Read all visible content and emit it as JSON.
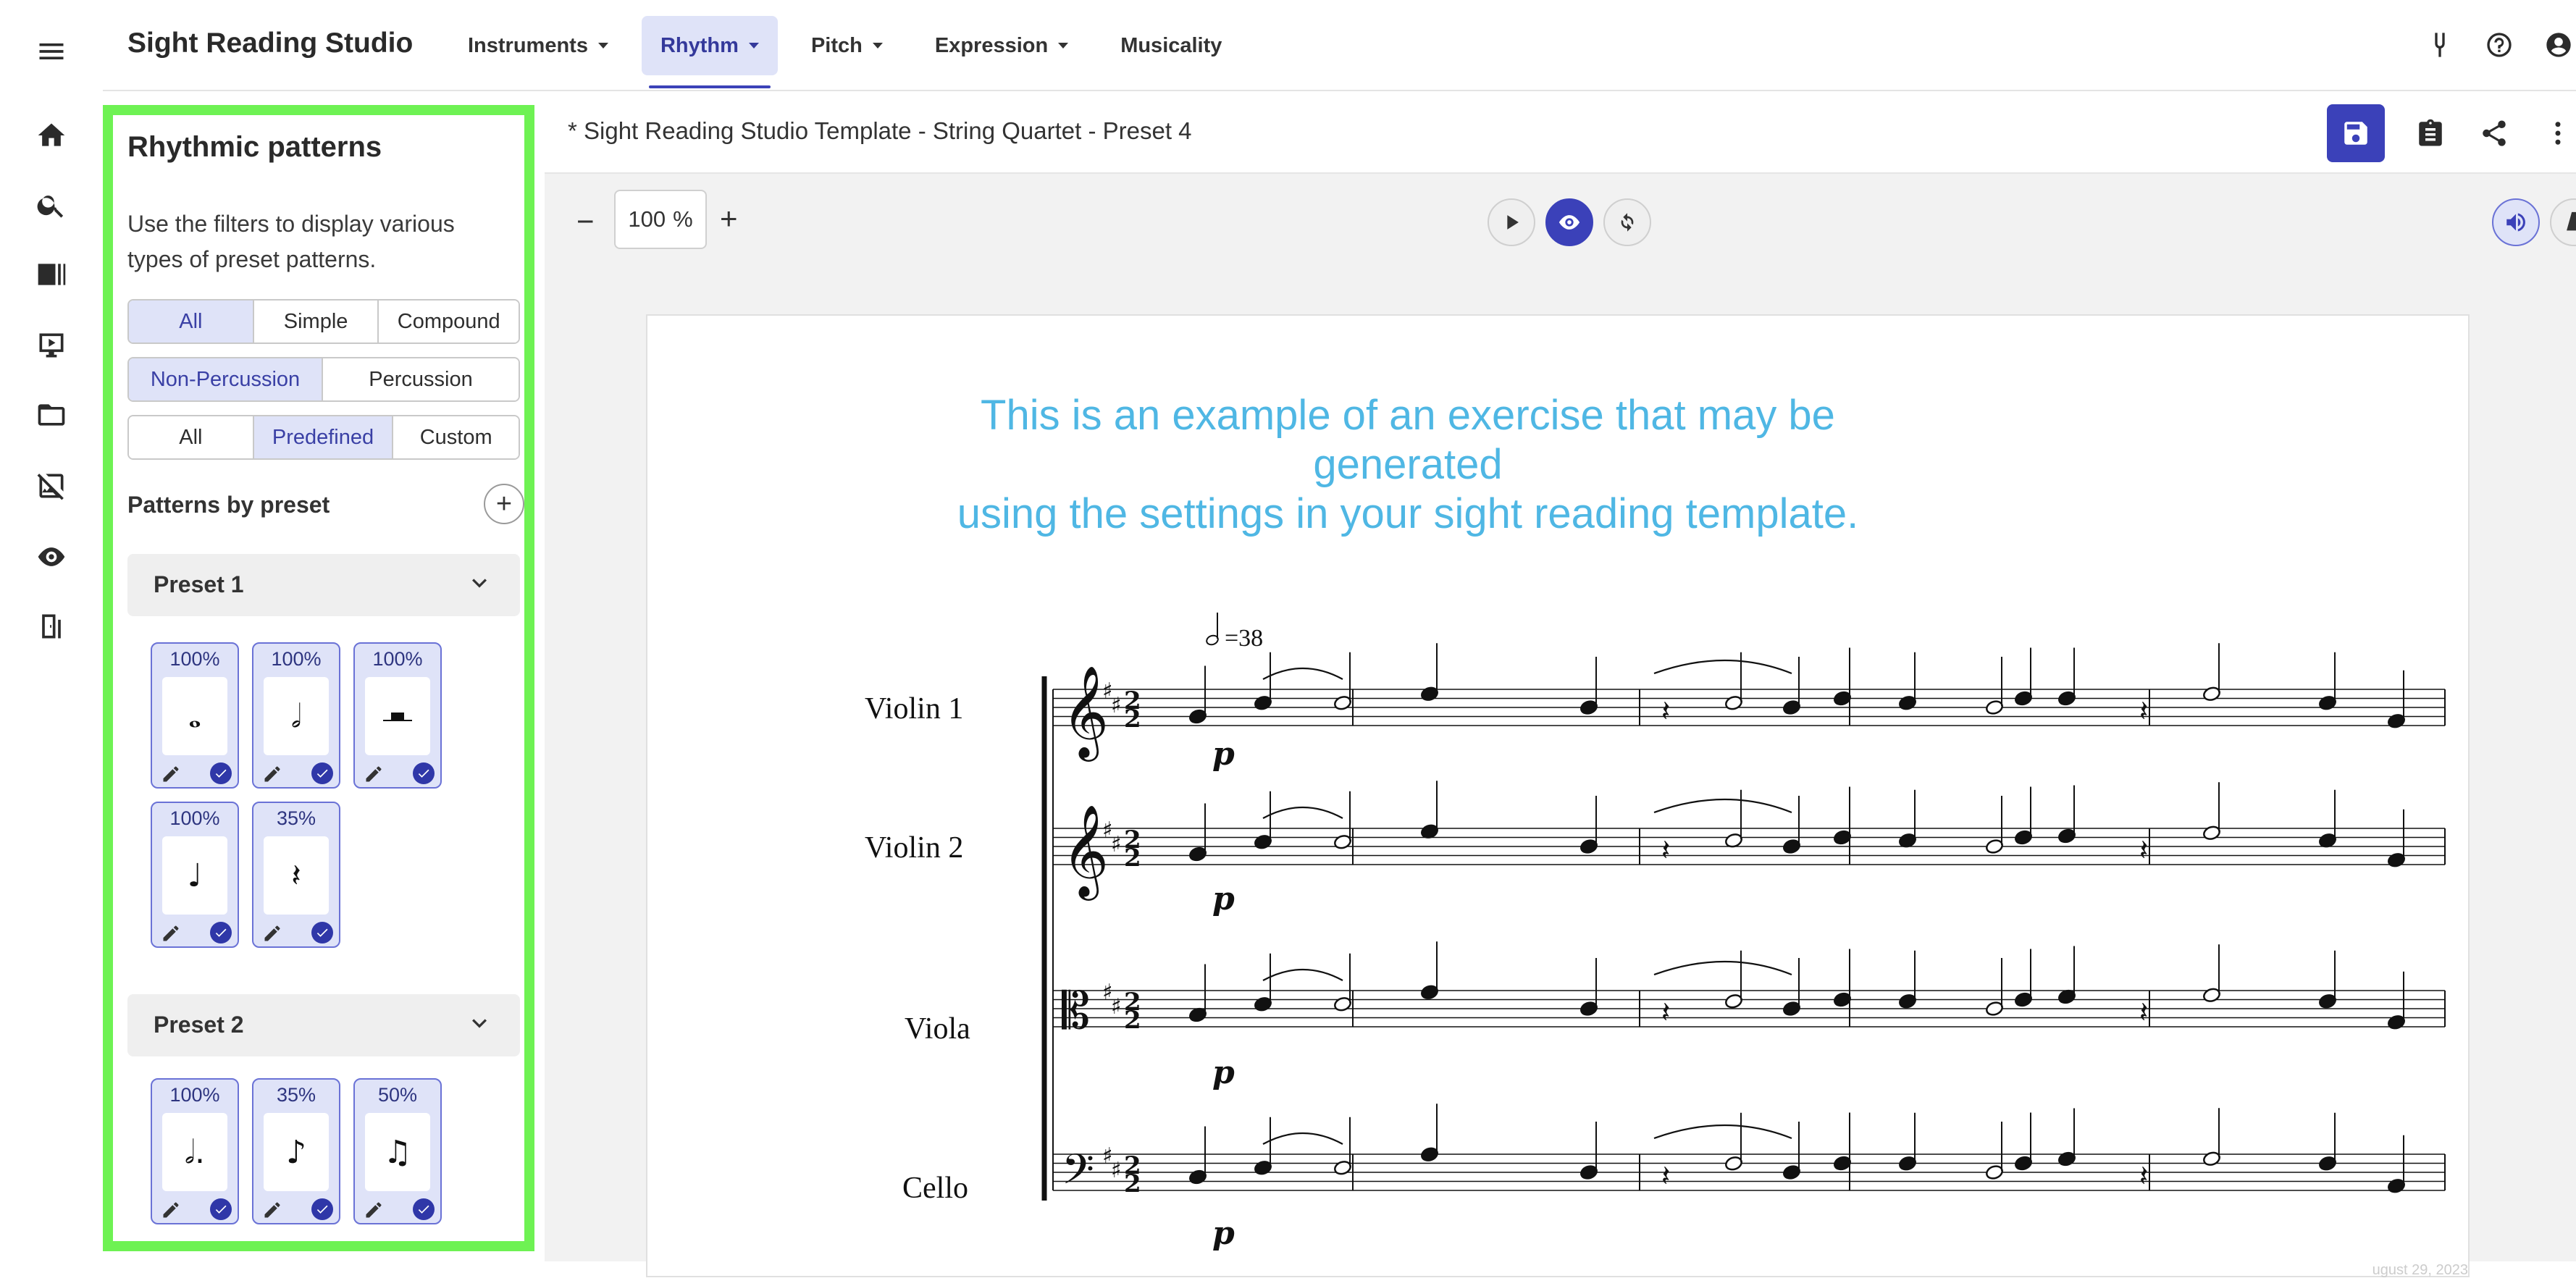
{
  "app": {
    "title": "Sight Reading Studio"
  },
  "nav": [
    {
      "label": "Instruments",
      "active": false,
      "dropdown": true
    },
    {
      "label": "Rhythm",
      "active": true,
      "dropdown": true
    },
    {
      "label": "Pitch",
      "active": false,
      "dropdown": true
    },
    {
      "label": "Expression",
      "active": false,
      "dropdown": true
    },
    {
      "label": "Musicality",
      "active": false,
      "dropdown": false
    }
  ],
  "panel": {
    "title": "Rhythmic patterns",
    "description": "Use the filters to display various types of preset patterns.",
    "filter_meter": [
      "All",
      "Simple",
      "Compound"
    ],
    "filter_meter_selected": "All",
    "filter_type": [
      "Non-Percussion",
      "Percussion"
    ],
    "filter_type_selected": "Non-Percussion",
    "filter_source": [
      "All",
      "Predefined",
      "Custom"
    ],
    "filter_source_selected": "Predefined",
    "patterns_label": "Patterns by preset",
    "presets": [
      {
        "name": "Preset 1",
        "cards": [
          {
            "percent": "100%",
            "note": "whole-note"
          },
          {
            "percent": "100%",
            "note": "half-note"
          },
          {
            "percent": "100%",
            "note": "half-rest"
          },
          {
            "percent": "100%",
            "note": "quarter-note"
          },
          {
            "percent": "35%",
            "note": "quarter-rest"
          }
        ]
      },
      {
        "name": "Preset 2",
        "cards": [
          {
            "percent": "100%",
            "note": "dotted-half-note"
          },
          {
            "percent": "35%",
            "note": "eighth-note"
          },
          {
            "percent": "50%",
            "note": "beamed-eighths"
          }
        ]
      }
    ]
  },
  "document": {
    "title": "* Sight Reading Studio Template - String Quartet - Preset 4"
  },
  "zoom": {
    "value": "100",
    "unit": "%"
  },
  "sheet": {
    "caption_line1": "This is an example of an exercise that may be generated",
    "caption_line2": "using the settings in your sight reading template.",
    "tempo_value": "=38",
    "instruments": [
      "Violin 1",
      "Violin 2",
      "Viola",
      "Cello"
    ],
    "dynamic": "p",
    "footer_date": "ugust 29, 2023"
  },
  "colors": {
    "accent": "#3b41b9",
    "highlight": "#6ef253",
    "caption": "#4fb7e4",
    "selected_bg": "#dfe3f8"
  }
}
